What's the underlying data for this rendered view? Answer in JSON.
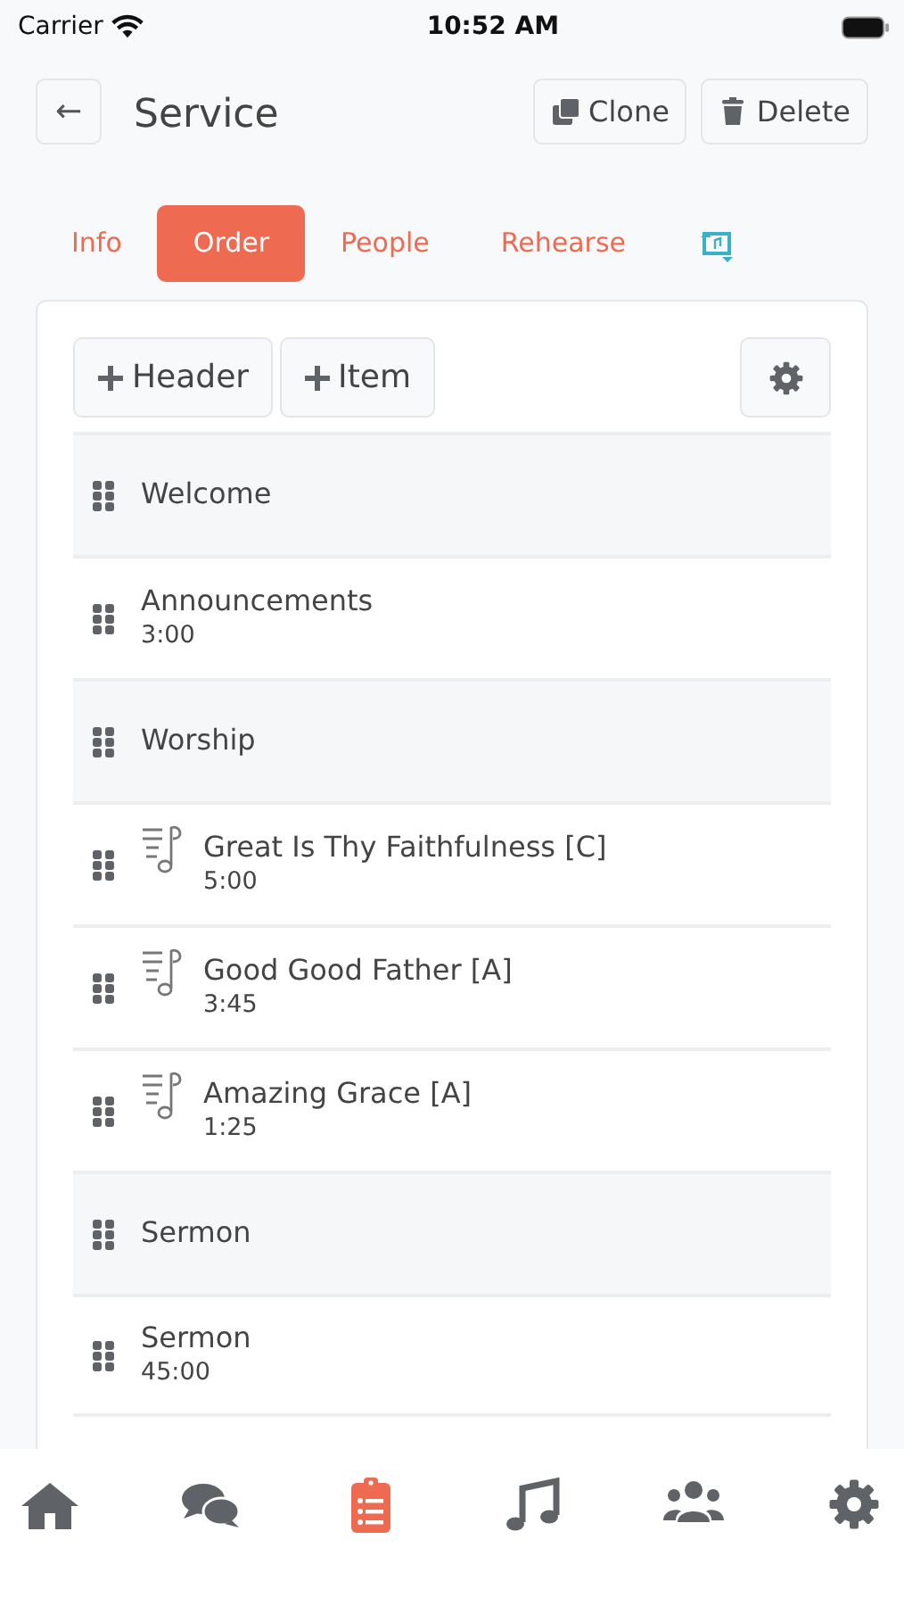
{
  "status_bar": {
    "carrier": "Carrier",
    "time": "10:52 AM"
  },
  "header": {
    "back": "←",
    "title": "Service",
    "buttons": [
      {
        "kind": "clone",
        "label": "Clone"
      },
      {
        "kind": "delete",
        "label": "Delete"
      }
    ]
  },
  "tabs": [
    {
      "kind": "text",
      "label": "Info",
      "selected": false
    },
    {
      "kind": "text",
      "label": "Order",
      "selected": true
    },
    {
      "kind": "text",
      "label": "People",
      "selected": false
    },
    {
      "kind": "text",
      "label": "Rehearse",
      "selected": false
    },
    {
      "kind": "icon",
      "selected": false
    }
  ],
  "toolbar": {
    "buttons": [
      {
        "kind": "add",
        "label": "Header"
      },
      {
        "kind": "add",
        "label": "Item"
      },
      {
        "kind": "settings"
      }
    ]
  },
  "order": [
    {
      "kind": "header",
      "title": "Welcome"
    },
    {
      "kind": "item",
      "title": "Announcements",
      "duration": "3:00"
    },
    {
      "kind": "header",
      "title": "Worship"
    },
    {
      "kind": "song",
      "title": "Great Is Thy Faithfulness [C]",
      "duration": "5:00"
    },
    {
      "kind": "song",
      "title": "Good Good Father [A]",
      "duration": "3:45"
    },
    {
      "kind": "song",
      "title": "Amazing Grace [A]",
      "duration": "1:25"
    },
    {
      "kind": "header",
      "title": "Sermon"
    },
    {
      "kind": "item",
      "title": "Sermon",
      "duration": "45:00"
    }
  ],
  "bottom_nav": [
    {
      "kind": "home",
      "selected": false
    },
    {
      "kind": "chat",
      "selected": false
    },
    {
      "kind": "order",
      "selected": true
    },
    {
      "kind": "music",
      "selected": false
    },
    {
      "kind": "people",
      "selected": false
    },
    {
      "kind": "settings",
      "selected": false
    }
  ]
}
